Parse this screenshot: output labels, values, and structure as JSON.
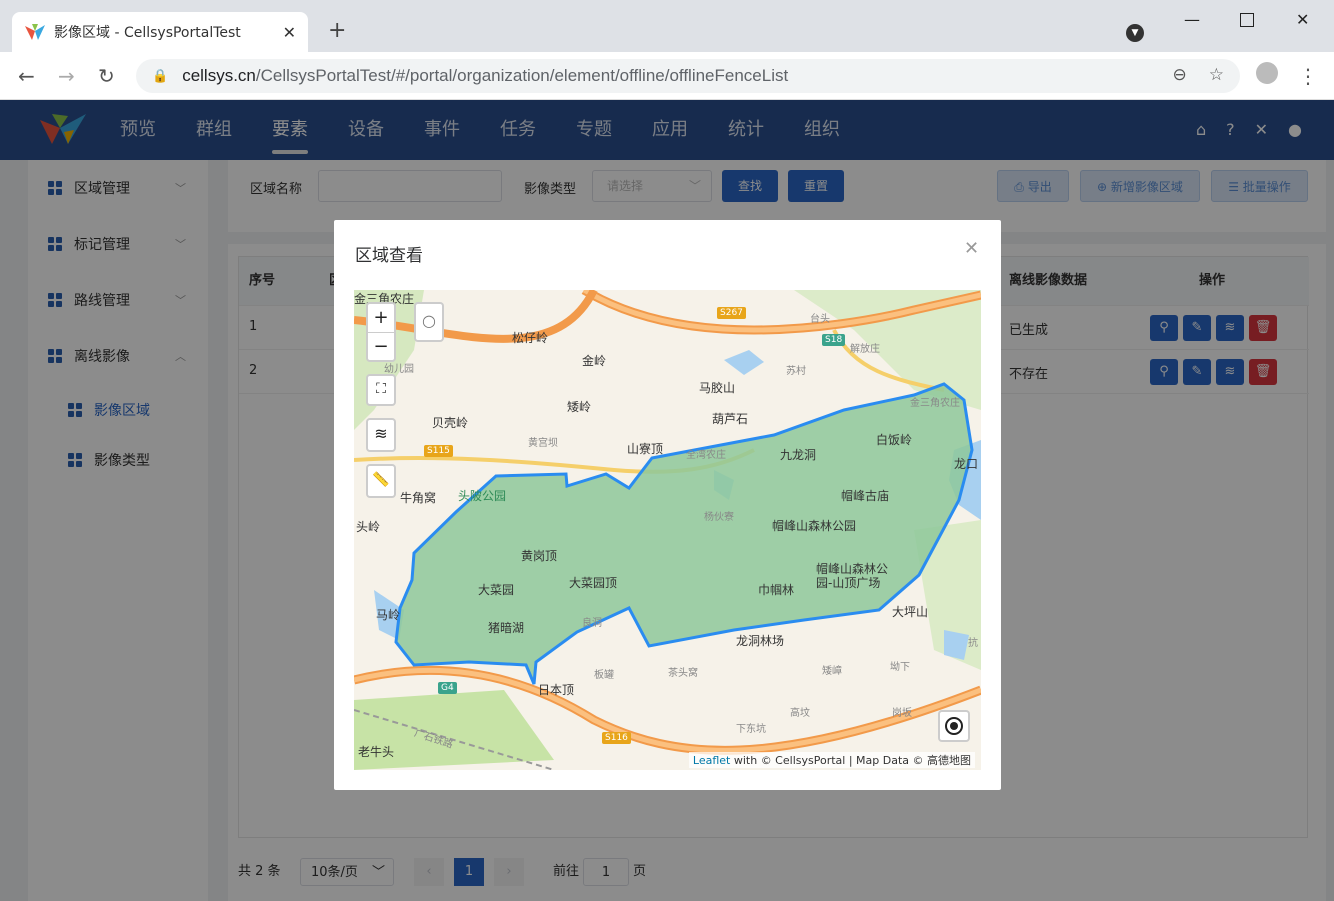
{
  "browser": {
    "tab_title": "影像区域 - CellsysPortalTest",
    "url_domain": "cellsys.cn",
    "url_path": "/CellsysPortalTest/#/portal/organization/element/offline/offlineFenceList"
  },
  "topnav": {
    "items": [
      "预览",
      "群组",
      "要素",
      "设备",
      "事件",
      "任务",
      "专题",
      "应用",
      "统计",
      "组织"
    ],
    "active": "要素"
  },
  "sidebar": {
    "items": [
      "区域管理",
      "标记管理",
      "路线管理",
      "离线影像"
    ],
    "sub_items": [
      "影像区域",
      "影像类型"
    ]
  },
  "search": {
    "name_label": "区域名称",
    "type_label": "影像类型",
    "type_placeholder": "请选择",
    "find": "查找",
    "reset": "重置",
    "export": "导出",
    "add": "新增影像区域",
    "batch": "批量操作"
  },
  "table": {
    "headers": {
      "index": "序号",
      "col2": "区",
      "data": "离线影像数据",
      "ops": "操作"
    },
    "rows": [
      {
        "index": "1",
        "data": "已生成"
      },
      {
        "index": "2",
        "data": "不存在"
      }
    ]
  },
  "pagination": {
    "total": "共 2 条",
    "page_size": "10条/页",
    "current": "1",
    "goto_label": "前往",
    "goto_value": "1",
    "page_suffix": "页"
  },
  "dialog": {
    "title": "区域查看",
    "map": {
      "labels": [
        "松仔岭",
        "金岭",
        "台头",
        "解放庄",
        "苏村",
        "马胶山",
        "矮岭",
        "葫芦石",
        "贝壳岭",
        "黄宫坝",
        "山寮顶",
        "全湾农庄",
        "九龙洞",
        "白饭岭",
        "龙口",
        "牛角窝",
        "头陂公园",
        "帽峰古庙",
        "杨伙寮",
        "帽峰山森林公园",
        "黄岗顶",
        "大菜园顶",
        "帽峰山森林公园-山顶广场",
        "大菜园",
        "巾帼林",
        "马岭",
        "猪暗湖",
        "良洞",
        "大坪山",
        "龙洞林场",
        "日本顶",
        "板罐",
        "茶头窝",
        "矮嶂",
        "坳下",
        "高坟",
        "岗坂",
        "下东坑",
        "老牛头",
        "广石铁路",
        "幼儿园",
        "头岭",
        "金三角农庄",
        "抗"
      ],
      "roads": [
        "S267",
        "S18",
        "S115",
        "G4",
        "S116"
      ],
      "attribution_leaflet": "Leaflet",
      "attribution_rest": " with © CellsysPortal | Map Data © 高德地图"
    }
  }
}
